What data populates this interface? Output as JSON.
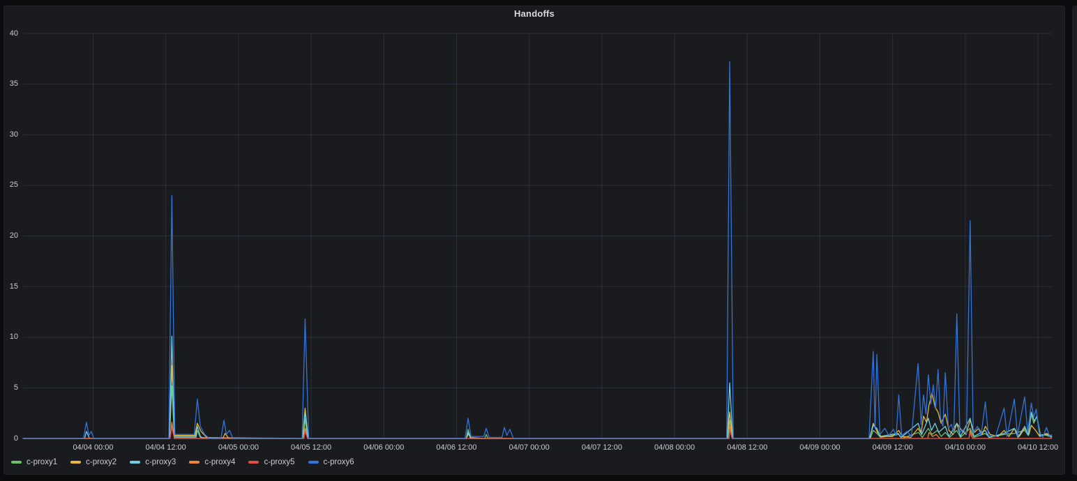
{
  "panel": {
    "title": "Handoffs"
  },
  "theme": {
    "page_background": "#0b0c0e",
    "panel_background": "#191b1f",
    "grid_color": "rgba(130,160,190,0.16)",
    "axis_text_color": "#c9ced4",
    "title_color": "#d8d9da"
  },
  "chart_data": {
    "type": "line",
    "title": "Handoffs",
    "grid": true,
    "legend_position": "bottom-left",
    "y_axis": {
      "ticks": [
        0,
        5,
        10,
        15,
        20,
        25,
        30,
        35,
        40
      ],
      "range": [
        0,
        40
      ]
    },
    "x_axis": {
      "unit": "hours relative to 04/04 00:00",
      "tick_step_hours": 12,
      "range_hours": [
        -11.6,
        158.3
      ],
      "tick_labels": [
        "04/04 00:00",
        "04/04 12:00",
        "04/05 00:00",
        "04/05 12:00",
        "04/06 00:00",
        "04/06 12:00",
        "04/07 00:00",
        "04/07 12:00",
        "04/08 00:00",
        "04/08 12:00",
        "04/09 00:00",
        "04/09 12:00",
        "04/10 00:00",
        "04/10 12:00"
      ]
    },
    "series": [
      {
        "name": "c-proxy1",
        "color": "#73BF69",
        "points": [
          [
            -11.6,
            0
          ],
          [
            12.6,
            0
          ],
          [
            13.0,
            5.2
          ],
          [
            13.4,
            0.1
          ],
          [
            17.0,
            0.1
          ],
          [
            17.2,
            0.8
          ],
          [
            17.7,
            0.1
          ],
          [
            34.7,
            0
          ],
          [
            35.0,
            2.0
          ],
          [
            35.4,
            0
          ],
          [
            61.6,
            0
          ],
          [
            61.9,
            0.9
          ],
          [
            62.3,
            0.1
          ],
          [
            64.7,
            0
          ],
          [
            64.9,
            0.4
          ],
          [
            65.2,
            0
          ],
          [
            104.8,
            0
          ],
          [
            105.1,
            1.8
          ],
          [
            105.5,
            0
          ],
          [
            128.3,
            0
          ],
          [
            128.8,
            0.8
          ],
          [
            129.4,
            0.5
          ],
          [
            130.0,
            0.1
          ],
          [
            133.0,
            0.4
          ],
          [
            133.5,
            0
          ],
          [
            136.3,
            0.6
          ],
          [
            136.9,
            0.1
          ],
          [
            137.9,
            1.0
          ],
          [
            138.5,
            0.4
          ],
          [
            139.4,
            0.8
          ],
          [
            140.0,
            0.2
          ],
          [
            140.7,
            0.6
          ],
          [
            141.4,
            0.1
          ],
          [
            142.6,
            0.8
          ],
          [
            143.2,
            0.1
          ],
          [
            144.8,
            1.0
          ],
          [
            145.4,
            0.1
          ],
          [
            147.3,
            0.5
          ],
          [
            148.0,
            0.1
          ],
          [
            150.4,
            0.4
          ],
          [
            152.1,
            0.5
          ],
          [
            153.8,
            0.8
          ],
          [
            154.4,
            0.3
          ],
          [
            154.9,
            2.4
          ],
          [
            155.3,
            1.5
          ],
          [
            155.8,
            2.2
          ],
          [
            156.4,
            0.4
          ],
          [
            157.4,
            0.3
          ],
          [
            158.3,
            0.1
          ]
        ]
      },
      {
        "name": "c-proxy2",
        "color": "#EAB839",
        "points": [
          [
            -11.6,
            0
          ],
          [
            12.6,
            0
          ],
          [
            13.0,
            7.2
          ],
          [
            13.5,
            0.3
          ],
          [
            16.8,
            0.3
          ],
          [
            17.2,
            1.5
          ],
          [
            17.8,
            0.7
          ],
          [
            18.6,
            0.2
          ],
          [
            19.5,
            0
          ],
          [
            21.4,
            0
          ],
          [
            21.8,
            0.5
          ],
          [
            22.4,
            0
          ],
          [
            34.6,
            0
          ],
          [
            35.0,
            3.0
          ],
          [
            35.5,
            0
          ],
          [
            61.6,
            0
          ],
          [
            62.0,
            0.5
          ],
          [
            62.4,
            0
          ],
          [
            104.7,
            0
          ],
          [
            105.1,
            2.6
          ],
          [
            105.6,
            0
          ],
          [
            128.2,
            0
          ],
          [
            128.8,
            1.5
          ],
          [
            129.5,
            0.6
          ],
          [
            130.1,
            0.2
          ],
          [
            132.0,
            0.2
          ],
          [
            133.0,
            0.8
          ],
          [
            133.6,
            0.2
          ],
          [
            135.0,
            0.1
          ],
          [
            136.2,
            1.0
          ],
          [
            136.7,
            0.5
          ],
          [
            137.1,
            2.2
          ],
          [
            137.6,
            1.6
          ],
          [
            138.0,
            3.3
          ],
          [
            138.5,
            4.5
          ],
          [
            139.0,
            3.1
          ],
          [
            139.5,
            2.6
          ],
          [
            140.0,
            1.5
          ],
          [
            140.7,
            2.4
          ],
          [
            141.3,
            0.8
          ],
          [
            142.0,
            0.4
          ],
          [
            142.6,
            1.5
          ],
          [
            143.4,
            0.8
          ],
          [
            144.1,
            0.4
          ],
          [
            144.8,
            1.8
          ],
          [
            145.5,
            0.6
          ],
          [
            146.2,
            1.0
          ],
          [
            146.8,
            0.4
          ],
          [
            147.3,
            1.2
          ],
          [
            148.1,
            0.4
          ],
          [
            149.4,
            0.2
          ],
          [
            150.4,
            0.8
          ],
          [
            151.2,
            0.2
          ],
          [
            152.1,
            1.0
          ],
          [
            152.9,
            0.2
          ],
          [
            153.8,
            1.0
          ],
          [
            154.5,
            0.4
          ],
          [
            154.9,
            1.3
          ],
          [
            155.6,
            0.8
          ],
          [
            156.3,
            0.2
          ],
          [
            157.4,
            0.5
          ],
          [
            158.3,
            0.2
          ]
        ]
      },
      {
        "name": "c-proxy3",
        "color": "#6ED0E0",
        "points": [
          [
            -11.6,
            0
          ],
          [
            -1.4,
            0
          ],
          [
            -1.1,
            0.7
          ],
          [
            -0.6,
            0
          ],
          [
            12.6,
            0
          ],
          [
            13.0,
            10.1
          ],
          [
            13.4,
            0.2
          ],
          [
            16.9,
            0.2
          ],
          [
            17.2,
            1.2
          ],
          [
            17.7,
            0.2
          ],
          [
            18.2,
            0
          ],
          [
            34.6,
            0
          ],
          [
            35.0,
            2.6
          ],
          [
            35.5,
            0
          ],
          [
            61.6,
            0
          ],
          [
            61.9,
            0.6
          ],
          [
            62.3,
            0
          ],
          [
            104.7,
            0
          ],
          [
            105.1,
            5.5
          ],
          [
            105.6,
            0
          ],
          [
            128.2,
            0
          ],
          [
            128.8,
            1.3
          ],
          [
            129.4,
            1.0
          ],
          [
            129.9,
            0.2
          ],
          [
            132.9,
            0.5
          ],
          [
            133.4,
            0.1
          ],
          [
            136.2,
            1.5
          ],
          [
            136.8,
            0.4
          ],
          [
            137.9,
            2.0
          ],
          [
            138.4,
            0.8
          ],
          [
            139.0,
            1.5
          ],
          [
            139.6,
            0.6
          ],
          [
            140.7,
            1.2
          ],
          [
            141.3,
            0.2
          ],
          [
            142.6,
            1.5
          ],
          [
            143.2,
            0.2
          ],
          [
            144.8,
            2.0
          ],
          [
            145.4,
            0.2
          ],
          [
            147.3,
            0.8
          ],
          [
            147.9,
            0.1
          ],
          [
            150.4,
            0.5
          ],
          [
            152.1,
            1.0
          ],
          [
            152.7,
            0.1
          ],
          [
            153.8,
            1.2
          ],
          [
            154.4,
            0.3
          ],
          [
            154.9,
            2.6
          ],
          [
            155.4,
            1.7
          ],
          [
            155.8,
            2.2
          ],
          [
            156.3,
            0.3
          ],
          [
            157.4,
            0.4
          ],
          [
            158.3,
            0.2
          ]
        ]
      },
      {
        "name": "c-proxy4",
        "color": "#EF843C",
        "points": [
          [
            -11.6,
            0
          ],
          [
            12.7,
            0
          ],
          [
            13.0,
            1.6
          ],
          [
            13.4,
            0
          ],
          [
            34.8,
            0
          ],
          [
            35.0,
            1.0
          ],
          [
            35.4,
            0
          ],
          [
            105.0,
            0
          ],
          [
            105.1,
            1.2
          ],
          [
            105.5,
            0
          ],
          [
            137.8,
            0
          ],
          [
            138.0,
            0.6
          ],
          [
            138.6,
            0.2
          ],
          [
            139.2,
            0.4
          ],
          [
            139.8,
            0
          ],
          [
            144.6,
            0
          ],
          [
            144.8,
            0.8
          ],
          [
            145.2,
            0
          ],
          [
            158.3,
            0
          ]
        ]
      },
      {
        "name": "c-proxy5",
        "color": "#E24D42",
        "points": [
          [
            -11.6,
            0
          ],
          [
            12.7,
            0
          ],
          [
            13.0,
            1.1
          ],
          [
            13.4,
            0
          ],
          [
            34.8,
            0
          ],
          [
            35.0,
            0.7
          ],
          [
            35.4,
            0
          ],
          [
            105.0,
            0
          ],
          [
            105.1,
            0.9
          ],
          [
            105.5,
            0
          ],
          [
            144.6,
            0
          ],
          [
            144.8,
            0.5
          ],
          [
            145.2,
            0
          ],
          [
            158.3,
            0
          ]
        ]
      },
      {
        "name": "c-proxy6",
        "color": "#3274D9",
        "points": [
          [
            -11.6,
            0
          ],
          [
            -1.6,
            0
          ],
          [
            -1.1,
            1.6
          ],
          [
            -0.7,
            0.3
          ],
          [
            -0.3,
            0.7
          ],
          [
            0.1,
            0
          ],
          [
            12.5,
            0
          ],
          [
            13.0,
            24.0
          ],
          [
            13.5,
            0.4
          ],
          [
            16.7,
            0.4
          ],
          [
            17.2,
            3.9
          ],
          [
            17.7,
            1.2
          ],
          [
            18.4,
            0.4
          ],
          [
            19.2,
            0
          ],
          [
            21.1,
            0
          ],
          [
            21.6,
            1.8
          ],
          [
            22.0,
            0.4
          ],
          [
            22.5,
            0.8
          ],
          [
            23.1,
            0
          ],
          [
            34.5,
            0
          ],
          [
            35.0,
            11.8
          ],
          [
            35.6,
            0
          ],
          [
            61.4,
            0
          ],
          [
            61.9,
            2.0
          ],
          [
            62.4,
            0.2
          ],
          [
            64.5,
            0.2
          ],
          [
            64.9,
            1.0
          ],
          [
            65.4,
            0.1
          ],
          [
            67.5,
            0.1
          ],
          [
            67.9,
            1.1
          ],
          [
            68.3,
            0.3
          ],
          [
            68.8,
            0.9
          ],
          [
            69.4,
            0
          ],
          [
            104.6,
            0
          ],
          [
            105.1,
            37.2
          ],
          [
            105.7,
            0
          ],
          [
            128.1,
            0
          ],
          [
            128.8,
            8.6
          ],
          [
            129.1,
            1.0
          ],
          [
            129.4,
            8.3
          ],
          [
            129.9,
            0.4
          ],
          [
            130.7,
            1.0
          ],
          [
            131.4,
            0.3
          ],
          [
            132.1,
            0.9
          ],
          [
            132.6,
            0.3
          ],
          [
            133.0,
            4.3
          ],
          [
            133.5,
            0.3
          ],
          [
            134.4,
            0.7
          ],
          [
            135.1,
            0.2
          ],
          [
            136.2,
            7.4
          ],
          [
            136.7,
            1.4
          ],
          [
            137.1,
            4.3
          ],
          [
            137.5,
            2.4
          ],
          [
            137.9,
            6.3
          ],
          [
            138.3,
            3.4
          ],
          [
            138.7,
            5.3
          ],
          [
            139.1,
            2.9
          ],
          [
            139.5,
            6.8
          ],
          [
            139.9,
            2.0
          ],
          [
            140.3,
            1.2
          ],
          [
            140.7,
            6.5
          ],
          [
            141.2,
            1.0
          ],
          [
            141.7,
            1.4
          ],
          [
            142.1,
            0.5
          ],
          [
            142.6,
            12.3
          ],
          [
            143.1,
            0.6
          ],
          [
            143.7,
            0.9
          ],
          [
            144.2,
            0.4
          ],
          [
            144.8,
            21.5
          ],
          [
            145.3,
            0.6
          ],
          [
            146.0,
            1.2
          ],
          [
            146.6,
            0.3
          ],
          [
            147.3,
            3.6
          ],
          [
            147.8,
            0.3
          ],
          [
            149.0,
            0.2
          ],
          [
            150.4,
            3.0
          ],
          [
            150.9,
            0.2
          ],
          [
            152.1,
            3.9
          ],
          [
            152.6,
            0.3
          ],
          [
            153.8,
            4.1
          ],
          [
            154.3,
            0.6
          ],
          [
            154.9,
            3.5
          ],
          [
            155.3,
            2.1
          ],
          [
            155.7,
            2.9
          ],
          [
            156.2,
            0.6
          ],
          [
            156.8,
            0.1
          ],
          [
            157.4,
            1.1
          ],
          [
            157.9,
            0.2
          ],
          [
            158.3,
            0.4
          ]
        ]
      }
    ]
  }
}
